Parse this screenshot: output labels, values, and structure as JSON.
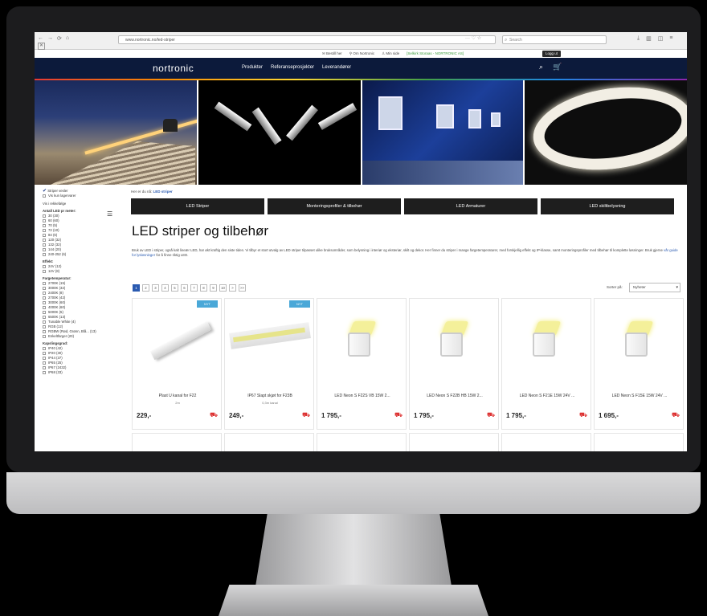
{
  "browser": {
    "url": "www.nortronic.no/led-striper",
    "search_placeholder": "Search",
    "nav": [
      "←",
      "→",
      "⟳",
      "⌂"
    ],
    "url_actions": "··· ♡ ☆",
    "tools": [
      "⤓",
      "▥",
      "◫",
      "≡"
    ]
  },
  "utility": {
    "items": [
      "Bestill her",
      "Om Nortronic",
      "Min side"
    ],
    "customer": "[Selkirk Storaas - NORTRONIC AS]",
    "login": "Logg ut"
  },
  "header": {
    "logo": "nortronic",
    "nav": [
      "Produkter",
      "Referanseprosjekter",
      "Leverandører"
    ],
    "search_icon": "⌕",
    "cart_icon": "🛒"
  },
  "breadcrumb": {
    "prefix": "Her er du nå:",
    "current": "LED striper"
  },
  "categories": [
    "LED Striper",
    "Monteringsprofiler & tilbehør",
    "LED Armaturer",
    "LED skiltbelysning"
  ],
  "page_title": "LED striper og tilbehør",
  "intro": {
    "text": "Bruk av LED i striper, også kalt lineær LED, har økt kraftig den siste tiden. Vi tilbyr et stort utvalg av LED striper tilpasset ulike bruksområder, som belysning i interiør og eksteriør, skilt og dekor. Her finner du striper i mange fargetemperaturer, med forskjellig effekt og IP-klasse, samt monteringsprofiler med tilbehør til komplette løsninger. Bruk gjerne",
    "link": "vår guide for lysløsninger",
    "tail": "for å finne riktig LED."
  },
  "pager": {
    "pages": [
      "1",
      "2",
      "3",
      "4",
      "5",
      "6",
      "7",
      "8",
      "9",
      "10",
      ">",
      ">>"
    ],
    "active": "1"
  },
  "sort": {
    "label": "Sorter på:",
    "value": "Nyheter",
    "arrow": "▾"
  },
  "sidebar": {
    "filter_checked": "Striper vesler",
    "filter_unchecked": "Vis kun lagervarer",
    "sort_label": "Vis i rekkefølge",
    "sort_icon": "☰",
    "checkbox_mark": "✔",
    "groups": [
      {
        "title": "Antall LED pr meter:",
        "items": [
          "30 (30)",
          "60 (60)",
          "70 (5)",
          "72 (10)",
          "84 (6)",
          "120 (32)",
          "132 (32)",
          "144 (20)",
          "240-252 (6)"
        ]
      },
      {
        "title": "Effekt:",
        "items": [
          "24V (12)",
          "12V (8)"
        ]
      },
      {
        "title": "Fargetemperatur:",
        "items": [
          "2700K (15)",
          "3000K (32)",
          "2400K (8)",
          "2700K (42)",
          "3000K (60)",
          "4000K (60)",
          "5000K (5)",
          "6500K (13)",
          "Tunable White (4)",
          "RGB (12)",
          "RGBW (Rød, Grønn, Blå... (13)",
          "Enkeltfarger (20)"
        ]
      },
      {
        "title": "Kapslingsgrad:",
        "items": [
          "IP40 (42)",
          "IP20 (30)",
          "IP44 (37)",
          "IP65 (25)",
          "IP67 (2432)",
          "IP68 (33)"
        ]
      }
    ]
  },
  "products": [
    {
      "name": "Plast U kanal for F22",
      "sub": "2m",
      "price": "229,-",
      "badge": "NYT"
    },
    {
      "name": "IP67 Slapt skjøt for F23B",
      "sub": "0,3m kanal",
      "price": "249,-",
      "badge": "NYT"
    },
    {
      "name": "LED Neon S F22S VB 15W 2...",
      "sub": "",
      "price": "1 795,-",
      "badge": ""
    },
    {
      "name": "LED Neon S F22B HB 15W 2...",
      "sub": "",
      "price": "1 795,-",
      "badge": ""
    },
    {
      "name": "LED Neon S F21E 15W 24V ...",
      "sub": "",
      "price": "1 795,-",
      "badge": ""
    },
    {
      "name": "LED Neon S F15E 15W 24V ...",
      "sub": "",
      "price": "1 695,-",
      "badge": ""
    }
  ],
  "cart_icon": "⛟",
  "colors": {
    "header_bg": "#0c1a3b",
    "accent": "#2a5ab0",
    "badge": "#4aa8d8",
    "cart": "#dd3333"
  }
}
